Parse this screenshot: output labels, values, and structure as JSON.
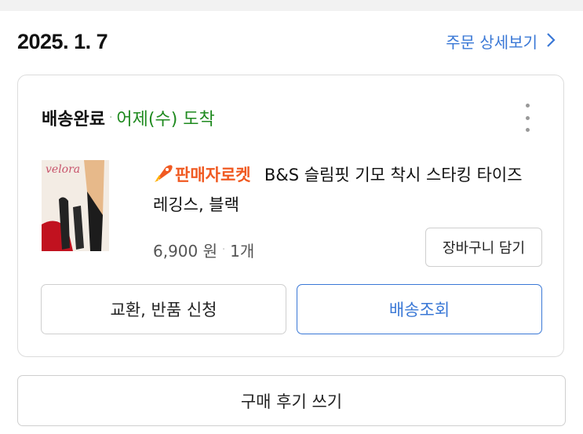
{
  "order": {
    "date": "2025. 1. 7",
    "detail_link_label": "주문 상세보기",
    "detail_link_icon": "chevron-right-icon"
  },
  "shipment": {
    "status": "배송완료",
    "arrival": "어제(수) 도착",
    "status_color": "#1f8a1f",
    "menu_icon": "more-vertical-icon"
  },
  "product": {
    "thumbnail_brand": "velora",
    "badge_label": "판매자로켓",
    "badge_icon": "rocket-icon",
    "badge_color": "#f05a22",
    "name": "B&S 슬림핏 기모 착시 스타킹 타이즈 레깅스, 블랙",
    "price": "6,900 원",
    "quantity": "1개"
  },
  "actions": {
    "add_to_cart": "장바구니 담기",
    "exchange_return": "교환, 반품 신청",
    "track_delivery": "배송조회",
    "write_review": "구매 후기 쓰기",
    "accent_color": "#3a78d6"
  }
}
